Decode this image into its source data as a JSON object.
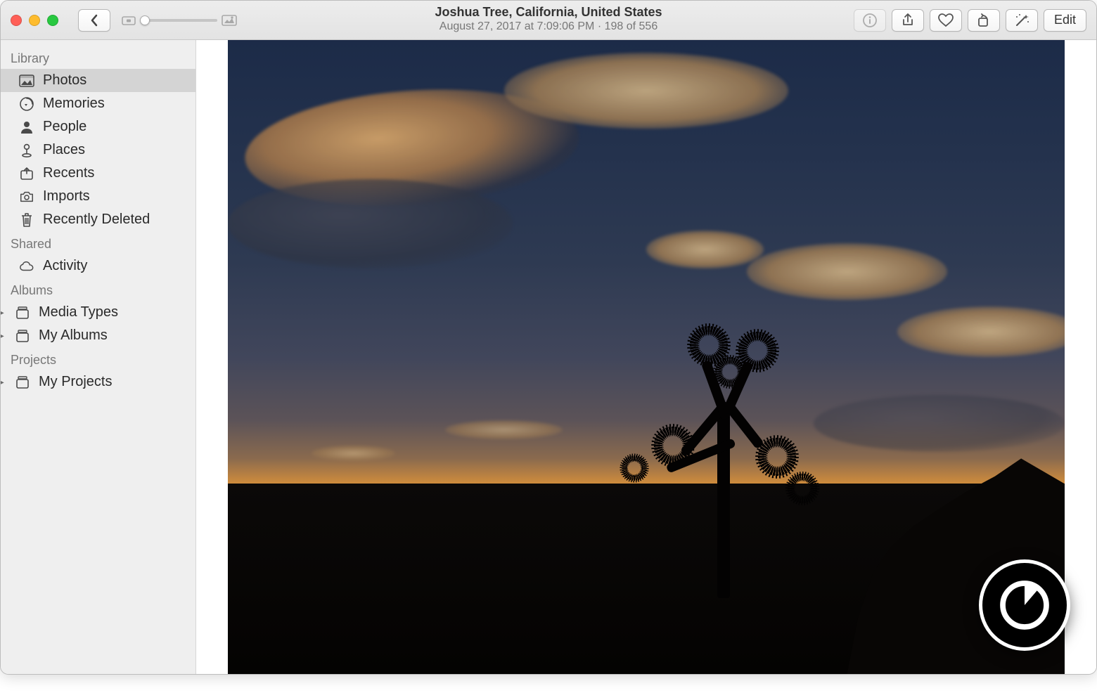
{
  "title": {
    "location": "Joshua Tree, California, United States",
    "subtitle": "August 27, 2017 at 7:09:06 PM  ·  198 of 556"
  },
  "toolbar": {
    "edit_label": "Edit"
  },
  "sidebar": {
    "sections": [
      {
        "header": "Library",
        "items": [
          {
            "label": "Photos",
            "icon": "photos",
            "selected": true
          },
          {
            "label": "Memories",
            "icon": "memories"
          },
          {
            "label": "People",
            "icon": "people"
          },
          {
            "label": "Places",
            "icon": "places"
          },
          {
            "label": "Recents",
            "icon": "recents"
          },
          {
            "label": "Imports",
            "icon": "imports"
          },
          {
            "label": "Recently Deleted",
            "icon": "trash"
          }
        ]
      },
      {
        "header": "Shared",
        "items": [
          {
            "label": "Activity",
            "icon": "cloud"
          }
        ]
      },
      {
        "header": "Albums",
        "items": [
          {
            "label": "Media Types",
            "icon": "stack",
            "disclosure": true
          },
          {
            "label": "My Albums",
            "icon": "stack",
            "disclosure": true
          }
        ]
      },
      {
        "header": "Projects",
        "items": [
          {
            "label": "My Projects",
            "icon": "stack",
            "disclosure": true
          }
        ]
      }
    ]
  }
}
